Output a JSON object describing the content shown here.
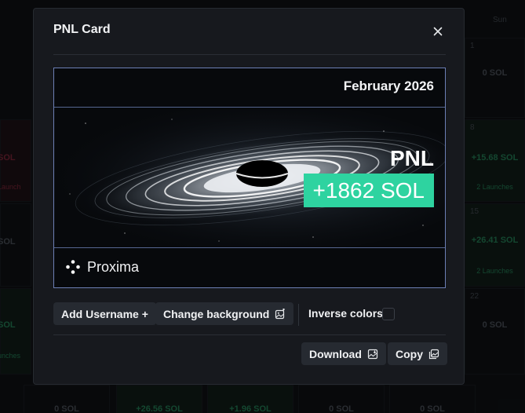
{
  "background": {
    "weekday_label": "Sun",
    "cells": [
      {
        "day": "1",
        "value": "0 SOL",
        "tone": "neu",
        "sub": ""
      },
      {
        "day": "8",
        "value": "+15.68 SOL",
        "tone": "pos",
        "sub": "2 Launches"
      },
      {
        "day": "15",
        "value": "+26.41 SOL",
        "tone": "pos",
        "sub": "2 Launches"
      },
      {
        "day": "22",
        "value": "0 SOL",
        "tone": "neu",
        "sub": ""
      },
      {
        "day": "",
        "value": "0 SOL",
        "tone": "neu",
        "sub": ""
      },
      {
        "day": "",
        "value": "+26.56 SOL",
        "tone": "pos",
        "sub": ""
      },
      {
        "day": "",
        "value": "+1.96 SOL",
        "tone": "pos",
        "sub": ""
      },
      {
        "day": "",
        "value": "0 SOL",
        "tone": "neu",
        "sub": ""
      },
      {
        "day": "",
        "value": "0 SOL",
        "tone": "neu",
        "sub": ""
      },
      {
        "day": "",
        "value": "SOL",
        "tone": "neg",
        "sub": "Launch"
      },
      {
        "day": "",
        "value": "SOL",
        "tone": "neu",
        "sub": ""
      },
      {
        "day": "",
        "value": "SOL",
        "tone": "pos",
        "sub": "unches"
      }
    ]
  },
  "modal": {
    "title": "PNL Card",
    "close_icon": "close-icon",
    "card": {
      "date": "February 2026",
      "pnl_label": "PNL",
      "pnl_value": "+1862 SOL",
      "brand_name": "Proxima",
      "brand_icon": "proxima-logo-icon",
      "accent_color": "#2ed3a0",
      "border_color": "#6c7fb5",
      "background_image": "black-hole-galaxy"
    },
    "actions": {
      "add_username": "Add Username +",
      "change_background": "Change background",
      "change_background_icon": "image-edit-icon",
      "inverse_colors": "Inverse colors",
      "inverse_checked": false,
      "download": "Download",
      "download_icon": "image-download-icon",
      "copy": "Copy",
      "copy_icon": "image-copy-icon"
    }
  }
}
